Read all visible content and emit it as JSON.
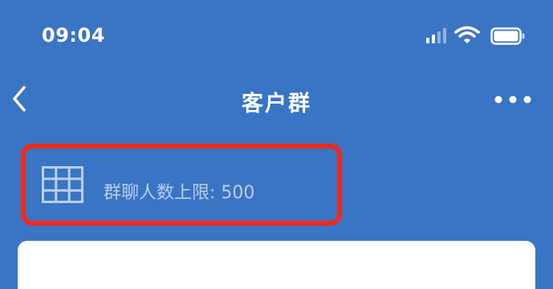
{
  "status_bar": {
    "time": "09:04",
    "icons": [
      "signal-icon",
      "wifi-icon",
      "battery-icon"
    ]
  },
  "nav": {
    "back_icon": "chevron-left-icon",
    "title": "客户群",
    "more_icon": "more-dots-icon"
  },
  "group_limit": {
    "icon": "grid-icon",
    "label": "群聊人数上限: 500"
  },
  "colors": {
    "background": "#3a74c4",
    "highlight_border": "#f0291c",
    "text_light": "#b9cfec"
  }
}
